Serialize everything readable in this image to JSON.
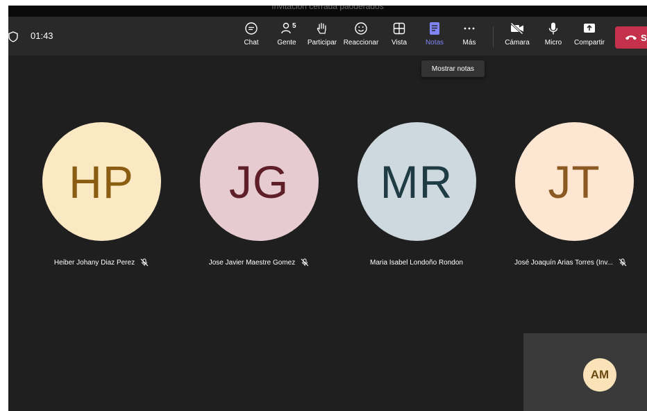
{
  "window": {
    "title": "Invitación cerrada paoderados"
  },
  "meeting": {
    "timer": "01:43"
  },
  "toolbar": {
    "chat": "Chat",
    "people": "Gente",
    "people_count": "5",
    "raise_hand": "Participar",
    "react": "Reaccionar",
    "view": "Vista",
    "notes": "Notas",
    "more": "Más",
    "camera": "Cámara",
    "mic": "Micro",
    "share": "Compartir",
    "leave": "S"
  },
  "tooltip": {
    "text": "Mostrar notas"
  },
  "participants": [
    {
      "initials": "HP",
      "name": "Heiber Johany Diaz Perez",
      "muted": true,
      "bg": "#fbe9c3",
      "fg": "#8a5d12"
    },
    {
      "initials": "JG",
      "name": "Jose Javier Maestre Gomez",
      "muted": true,
      "bg": "#e6cbd1",
      "fg": "#5e1f28"
    },
    {
      "initials": "MR",
      "name": "Maria Isabel Londoño Rondon",
      "muted": false,
      "bg": "#cdd9df",
      "fg": "#1f3b44"
    },
    {
      "initials": "JT",
      "name": "José Joaquín Arias Torres (Inv...",
      "muted": true,
      "bg": "#fde6d2",
      "fg": "#8a5a22"
    }
  ],
  "self": {
    "initials": "AM"
  },
  "colors": {
    "accent": "#7f85f5",
    "leave": "#c4314b",
    "stage": "#1f1f1f",
    "toolbar": "#292929"
  }
}
